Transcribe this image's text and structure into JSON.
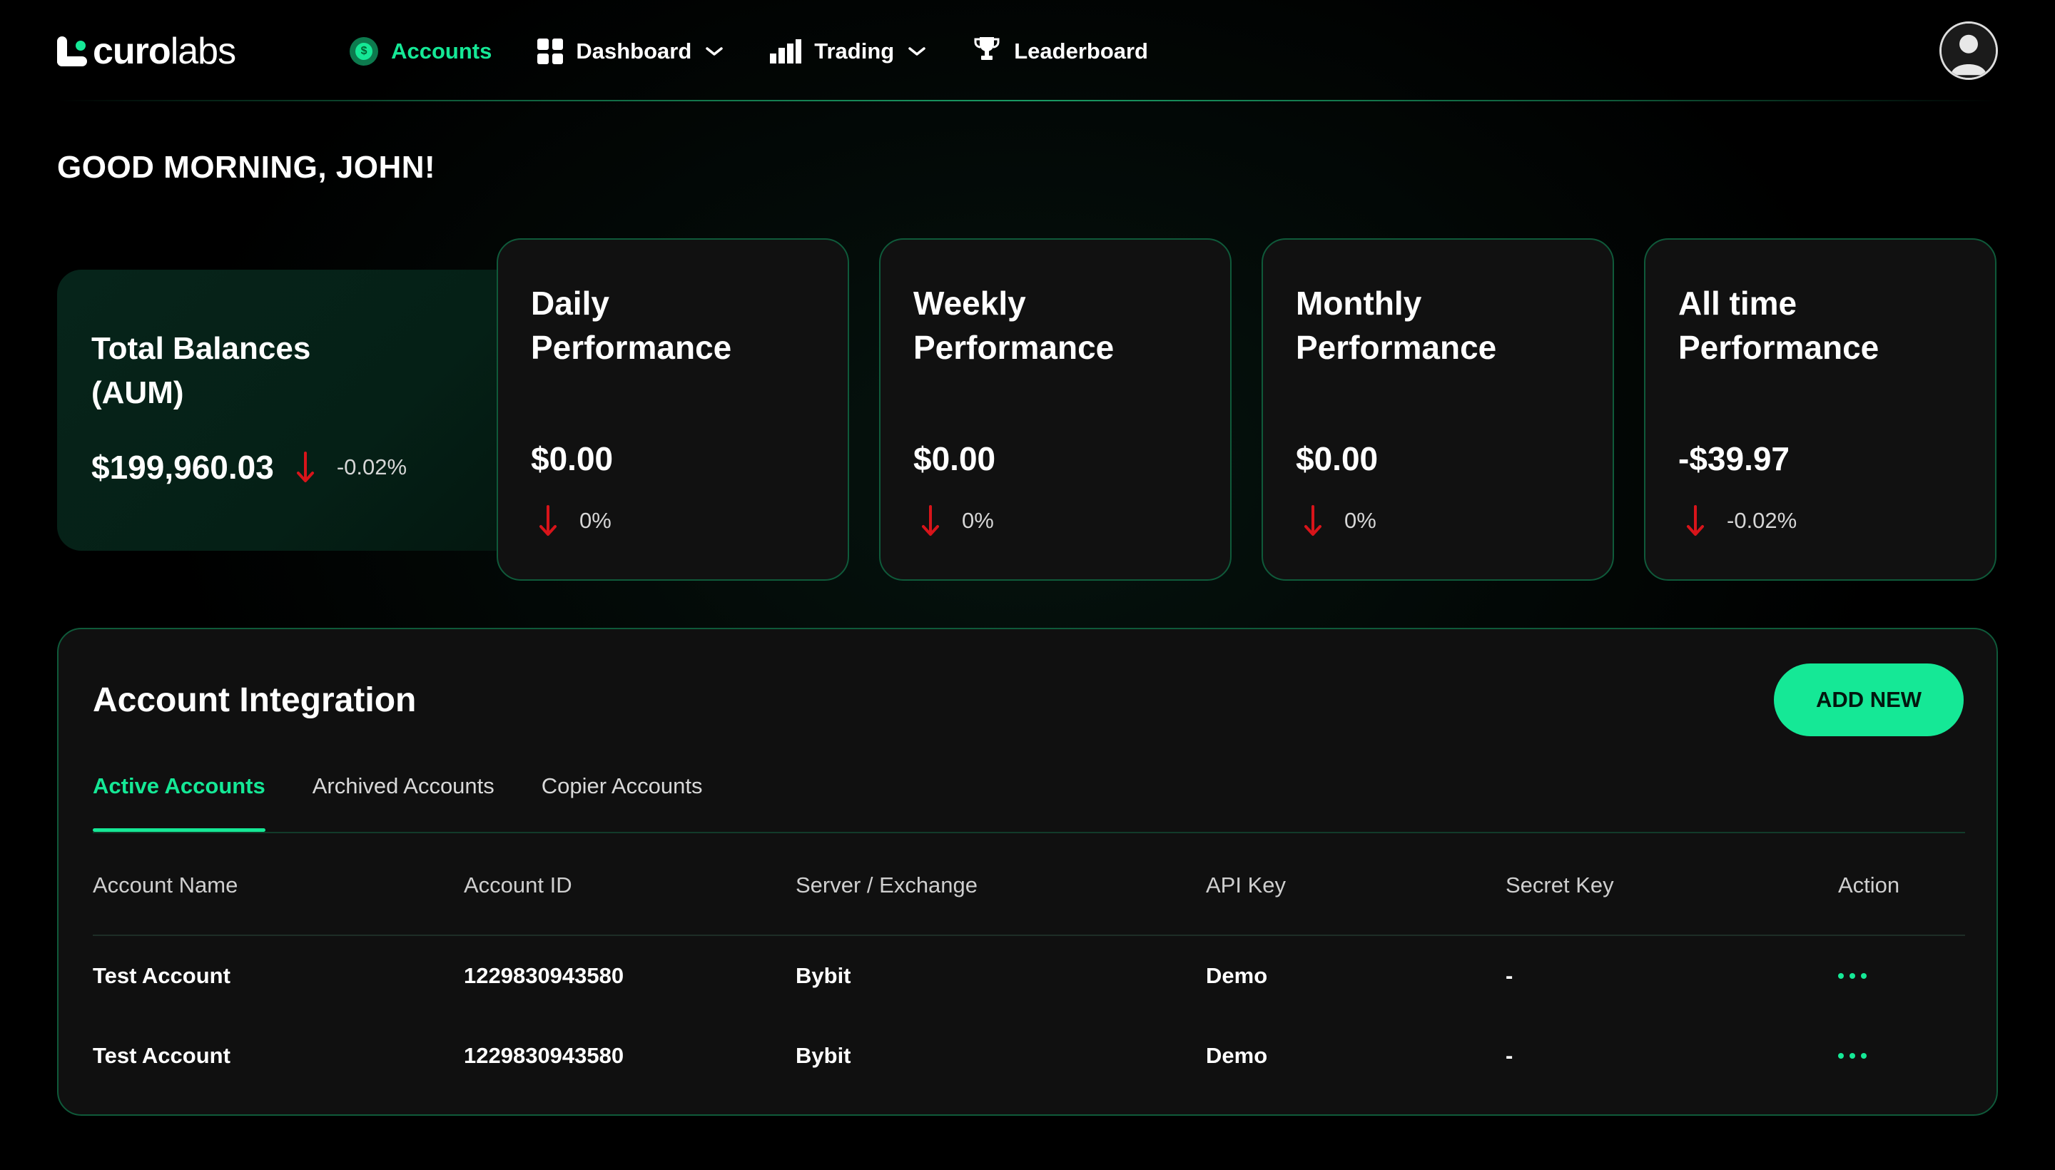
{
  "brand": {
    "name_bold": "curo",
    "name_light": "labs",
    "accent": "#15e896"
  },
  "nav": [
    {
      "label": "Accounts",
      "icon": "coin-icon",
      "active": true
    },
    {
      "label": "Dashboard",
      "icon": "grid-icon",
      "dropdown": true
    },
    {
      "label": "Trading",
      "icon": "bar-chart-icon",
      "dropdown": true
    },
    {
      "label": "Leaderboard",
      "icon": "trophy-icon"
    }
  ],
  "user": {
    "avatar": "user-avatar-icon"
  },
  "greeting": "GOOD MORNING, JOHN!",
  "total": {
    "title_line1": "Total Balances",
    "title_line2": "(AUM)",
    "value": "$199,960.03",
    "change": "-0.02%",
    "trend": "down"
  },
  "performance": [
    {
      "line1": "Daily",
      "line2": "Performance",
      "value": "$0.00",
      "change": "0%",
      "trend": "down"
    },
    {
      "line1": "Weekly",
      "line2": "Performance",
      "value": "$0.00",
      "change": "0%",
      "trend": "down"
    },
    {
      "line1": "Monthly",
      "line2": "Performance",
      "value": "$0.00",
      "change": "0%",
      "trend": "down"
    },
    {
      "line1": "All time",
      "line2": "Performance",
      "value": "-$39.97",
      "change": "-0.02%",
      "trend": "down"
    }
  ],
  "integration": {
    "title": "Account Integration",
    "add_button": "ADD NEW",
    "tabs": [
      {
        "label": "Active Accounts",
        "active": true
      },
      {
        "label": "Archived Accounts"
      },
      {
        "label": "Copier Accounts"
      }
    ],
    "columns": [
      "Account Name",
      "Account ID",
      "Server / Exchange",
      "API Key",
      "Secret Key",
      "Action"
    ],
    "rows": [
      {
        "name": "Test Account",
        "id": "1229830943580",
        "server": "Bybit",
        "api_key": "Demo",
        "secret_key": "-",
        "action": "more-options-icon"
      },
      {
        "name": "Test Account",
        "id": "1229830943580",
        "server": "Bybit",
        "api_key": "Demo",
        "secret_key": "-",
        "action": "more-options-icon"
      }
    ]
  },
  "colors": {
    "down": "#d8141a",
    "card_border": "#0f5a3a"
  }
}
